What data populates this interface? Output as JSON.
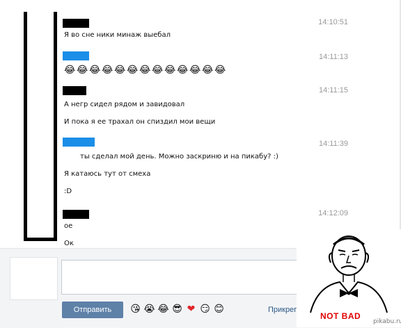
{
  "messages": [
    {
      "time": "14:10:51",
      "lines": [
        "Я во сне ники минаж выебал"
      ]
    },
    {
      "time": "14:11:13",
      "emoji_count": 13
    },
    {
      "time": "14:11:15",
      "lines": [
        "А негр сидел рядом и завидовал",
        "И пока я ее трахал он спиздил мои вещи"
      ]
    },
    {
      "time": "14:11:39",
      "lines": [
        "ты сделал мой день. Можно заскриню и на пикабу? :)",
        "Я катаюсь тут от смеха",
        ":D"
      ]
    },
    {
      "time": "14:12:09",
      "lines": [
        "ое",
        "Ок"
      ]
    }
  ],
  "composer": {
    "send_label": "Отправить",
    "attach_label": "Прикрепить"
  },
  "meme": {
    "caption": "NOT BAD",
    "watermark": "pikabu.ru"
  },
  "icons": {
    "laugh": "😂",
    "blush_wink": "😘",
    "cry": "😭",
    "sunglasses": "😎",
    "heart": "❤",
    "smirk": "😏",
    "smile": "😊"
  }
}
